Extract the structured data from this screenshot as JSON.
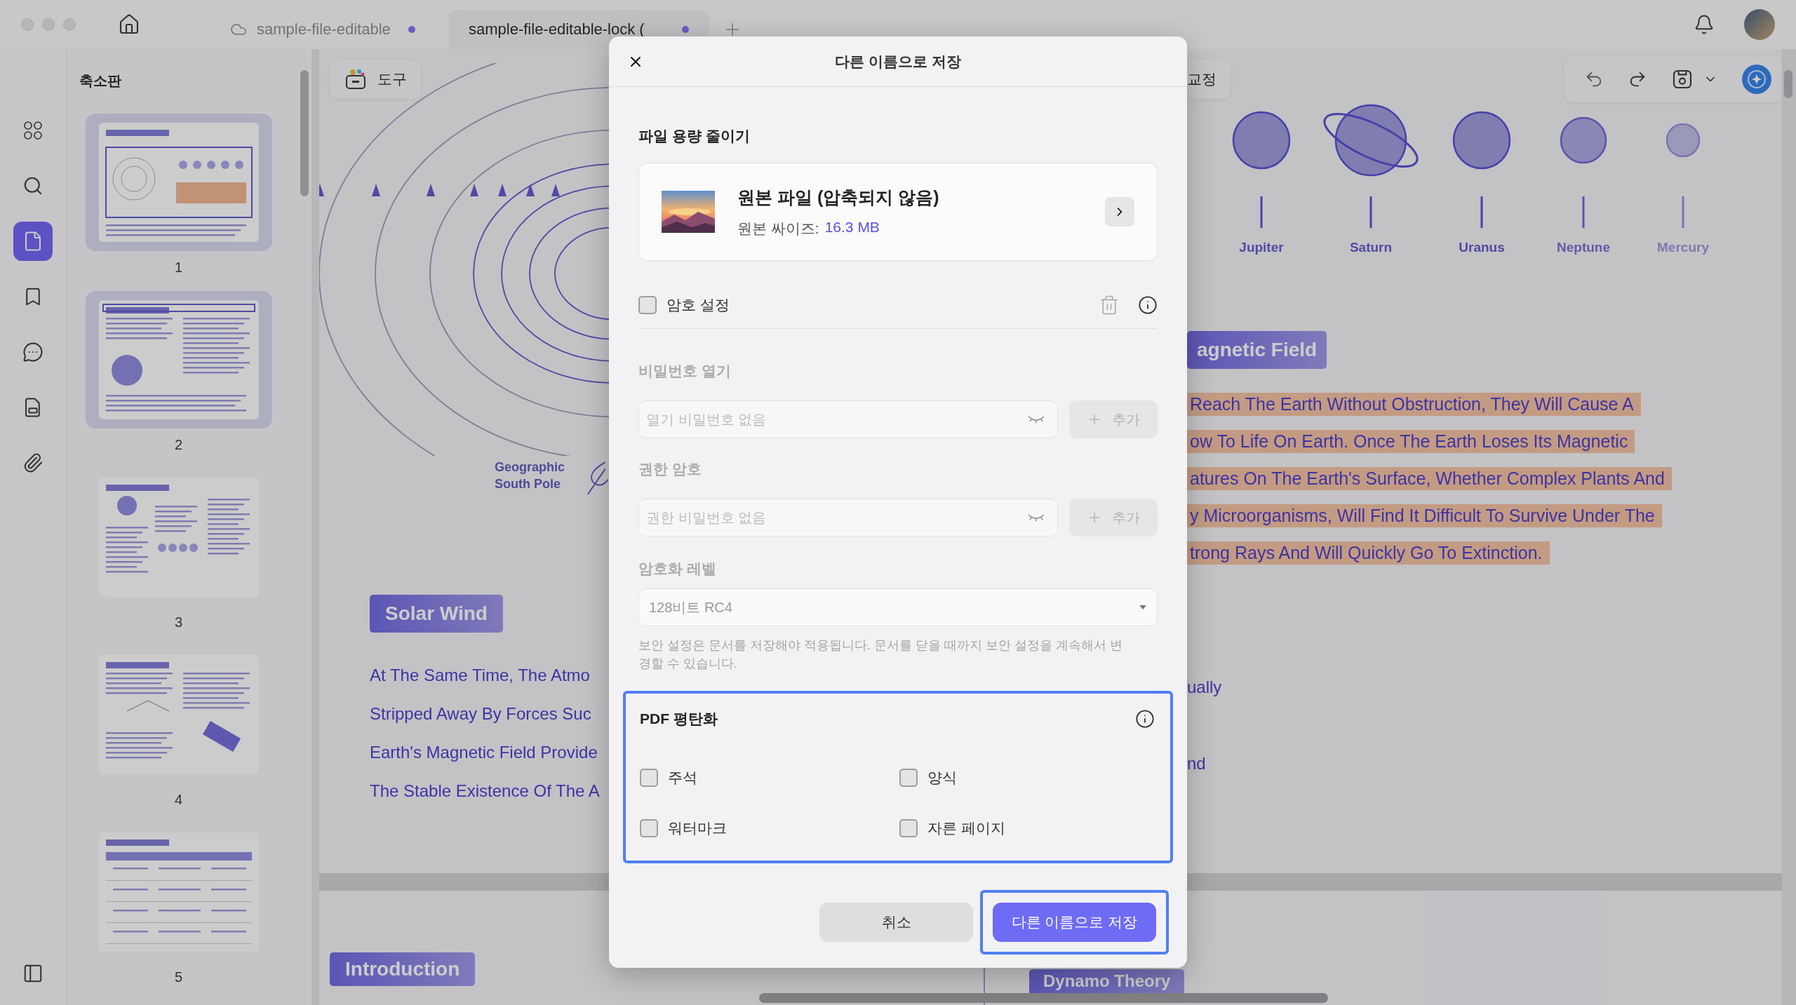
{
  "tabs": [
    {
      "label": "sample-file-editable",
      "selected": false,
      "cloud": true,
      "modified": true
    },
    {
      "label": "sample-file-editable-lock (",
      "selected": true,
      "cloud": false,
      "modified": true
    }
  ],
  "rail": [
    {
      "kind": "apps",
      "selected": false
    },
    {
      "kind": "search",
      "selected": false
    },
    {
      "kind": "pages",
      "selected": true
    },
    {
      "kind": "bookmarks",
      "selected": false
    },
    {
      "kind": "comments",
      "selected": false
    },
    {
      "kind": "forms",
      "selected": false
    },
    {
      "kind": "attachments",
      "selected": false
    }
  ],
  "thumbnails": {
    "title": "축소판",
    "pages": [
      {
        "number": "1",
        "selected": true
      },
      {
        "number": "2",
        "selected": true
      },
      {
        "number": "3",
        "selected": false
      },
      {
        "number": "4",
        "selected": false
      },
      {
        "number": "5",
        "selected": false
      }
    ]
  },
  "toolbar": {
    "tools": "도구",
    "proofread": "교정"
  },
  "document": {
    "figure_label": "Geographic South Pole",
    "left_heading": "Solar Wind",
    "left_lines": [
      "At The Same Time, The Atmo",
      "Stripped Away By Forces Suc",
      "Earth's Magnetic Field Provide",
      "The Stable Existence Of The A"
    ],
    "planets": [
      {
        "name": "Jupiter",
        "ringed": false
      },
      {
        "name": "Saturn",
        "ringed": true
      },
      {
        "name": "Uranus",
        "ringed": false
      },
      {
        "name": "Neptune",
        "ringed": false
      },
      {
        "name": "Mercury",
        "ringed": false
      }
    ],
    "right_heading": "agnetic Field",
    "highlighted_lines": [
      "Reach The Earth Without Obstruction, They Will Cause A",
      "ow To Life On Earth. Once The Earth Loses Its Magnetic",
      "atures On The Earth's Surface, Whether Complex Plants And",
      "y Microorganisms, Will Find It Difficult To Survive Under The",
      "trong Rays And Will Quickly Go To Extinction."
    ],
    "right_lines": [
      "ually",
      "nd"
    ],
    "next_page": {
      "left_heading": "Introduction",
      "middle_heading": "Dynamo Theory"
    }
  },
  "dialog": {
    "title": "다른 이름으로 저장",
    "compress": {
      "heading": "파일 용량 줄이기",
      "option_title": "원본 파일 (압축되지 않음)",
      "size_label": "원본 싸이즈:",
      "size_value": "16.3 MB"
    },
    "password": {
      "label": "암호 설정",
      "checked": false
    },
    "open_password": {
      "label": "비밀번호 열기",
      "placeholder": "열기 비밀번호 없음",
      "add": "추가",
      "disabled": true
    },
    "permission_password": {
      "label": "권한 암호",
      "placeholder": "권한 비밀번호 없음",
      "add": "추가",
      "disabled": true
    },
    "encryption": {
      "label": "암호화 레벨",
      "value": "128비트 RC4",
      "disabled": true
    },
    "note": "보안 설정은 문서를 저장해야 적용됩니다. 문서를 닫을 때까지 보안 설정을 계속해서 변경할 수 있습니다.",
    "flatten": {
      "heading": "PDF 평탄화",
      "highlighted": true,
      "options": [
        {
          "label": "주석",
          "checked": false
        },
        {
          "label": "양식",
          "checked": false
        },
        {
          "label": "워터마크",
          "checked": false
        },
        {
          "label": "자른 페이지",
          "checked": false
        }
      ]
    },
    "buttons": [
      {
        "label": "취소",
        "kind": "secondary",
        "highlighted": false
      },
      {
        "label": "다른 이름으로 저장",
        "kind": "primary",
        "highlighted": true
      }
    ]
  }
}
